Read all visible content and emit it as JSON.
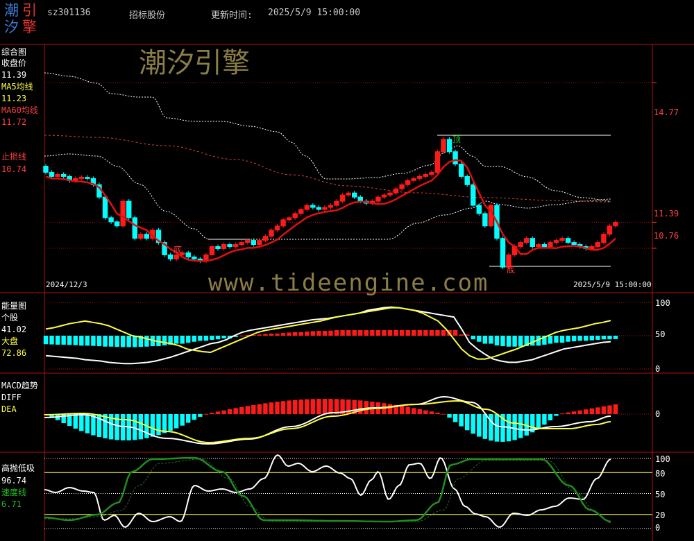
{
  "logo": {
    "c1": "潮",
    "c2": "引",
    "c3": "汐",
    "c4": "擎"
  },
  "header": {
    "code": "sz301136",
    "name": "招标股份",
    "update_label": "更新时间:",
    "update_time": "2025/5/9 15:00:00"
  },
  "watermark": {
    "brand": "潮汐引擎",
    "url": "www.tideengine.com"
  },
  "colors": {
    "up": "#ff1a1a",
    "down": "#00ffff",
    "ma": "#e01010",
    "white": "#ffffff",
    "yellow": "#ffff40",
    "green": "#1f8f1f",
    "grid": "#b01010",
    "axis": "#ff4040"
  },
  "main_panel": {
    "title": "综合图",
    "close_label": "收盘价",
    "close_value": "11.39",
    "ma5_label": "MA5均线",
    "ma5_value": "11.23",
    "ma60_label": "MA60均线",
    "ma60_value": "11.72",
    "stop_label": "止损线",
    "stop_value": "10.74",
    "y_labels": [
      "14.77",
      "11.39",
      "10.76"
    ],
    "date_start": "2024/12/3",
    "date_end": "2025/5/9 15:00:00",
    "markers": [
      {
        "text": "顶"
      },
      {
        "text": "底"
      },
      {
        "text": "底"
      }
    ]
  },
  "energy_panel": {
    "title": "能量图",
    "stock_label": "个股",
    "stock_value": "41.02",
    "market_label": "大盘",
    "market_value": "72.86",
    "y_labels": [
      "100",
      "50",
      "0"
    ]
  },
  "macd_panel": {
    "title": "MACD趋势",
    "diff_label": "DIFF",
    "dea_label": "DEA",
    "y_labels": [
      "0"
    ]
  },
  "hl_panel": {
    "title": "高抛低吸",
    "value1": "96.74",
    "speed_label": "速度线",
    "speed_value": "6.71",
    "y_labels": [
      "100",
      "80",
      "50",
      "20",
      "0"
    ]
  },
  "chart_data": [
    {
      "type": "candlestick",
      "series": [
        {
          "name": "收盘价",
          "values": [
            12.6,
            12.5,
            12.55,
            12.5,
            12.4,
            12.45,
            12.48,
            12.45,
            12.3,
            12.0,
            11.5,
            11.4,
            11.3,
            11.9,
            11.5,
            11.0,
            11.1,
            11.0,
            11.2,
            10.9,
            10.6,
            10.5,
            10.6,
            10.65,
            10.55,
            10.5,
            10.45,
            10.6,
            10.8,
            10.75,
            10.85,
            10.8,
            10.85,
            10.9,
            10.95,
            10.85,
            10.95,
            11.05,
            11.2,
            11.3,
            11.45,
            11.5,
            11.6,
            11.7,
            11.8,
            11.75,
            11.7,
            11.75,
            11.8,
            11.9,
            12.05,
            12.1,
            12.0,
            11.9,
            11.85,
            11.9,
            12.0,
            12.05,
            12.1,
            12.2,
            12.3,
            12.4,
            12.45,
            12.5,
            12.55,
            12.6,
            13.1,
            13.4,
            13.1,
            12.8,
            12.5,
            12.3,
            11.8,
            11.6,
            11.3,
            11.8,
            11.0,
            10.3,
            10.6,
            10.8,
            10.9,
            11.0,
            10.8,
            10.85,
            10.8,
            10.9,
            10.95,
            11.0,
            10.9,
            10.85,
            10.8,
            10.75,
            10.8,
            10.9,
            11.1,
            11.3,
            11.39
          ]
        },
        {
          "name": "MA5均线",
          "values": []
        },
        {
          "name": "MA60均线",
          "values": []
        }
      ],
      "ylim": [
        9.8,
        15.6
      ],
      "y_ticks": [
        14.77,
        11.39,
        10.76
      ]
    },
    {
      "type": "line",
      "series": [
        {
          "name": "个股",
          "values": [
            20,
            19,
            18,
            17,
            16,
            14,
            13,
            12,
            10,
            9,
            8,
            8,
            9,
            10,
            12,
            15,
            18,
            22,
            26,
            30,
            34,
            38,
            40,
            44,
            50,
            55,
            58,
            60,
            62,
            64,
            66,
            68,
            70,
            72,
            74,
            75,
            76,
            78,
            80,
            82,
            84,
            88,
            90,
            92,
            93,
            92,
            90,
            88,
            86,
            84,
            82,
            80,
            78,
            60,
            40,
            30,
            22,
            15,
            12,
            10,
            10,
            12,
            14,
            18,
            22,
            26,
            30,
            32,
            34,
            36,
            38,
            40,
            41.02
          ]
        },
        {
          "name": "大盘",
          "values": [
            60,
            62,
            65,
            68,
            70,
            72,
            70,
            68,
            65,
            60,
            55,
            50,
            48,
            45,
            42,
            40,
            38,
            35,
            30,
            28,
            26,
            25,
            30,
            35,
            40,
            45,
            50,
            55,
            58,
            60,
            62,
            64,
            66,
            68,
            70,
            72,
            75,
            78,
            80,
            82,
            84,
            86,
            88,
            90,
            92,
            92,
            90,
            88,
            84,
            78,
            72,
            60,
            45,
            30,
            20,
            15,
            15,
            18,
            22,
            26,
            30,
            35,
            40,
            45,
            50,
            55,
            58,
            60,
            62,
            65,
            68,
            70,
            72.86
          ]
        }
      ],
      "ylim": [
        0,
        100
      ],
      "y_ticks": [
        100,
        50,
        0
      ]
    },
    {
      "type": "bar",
      "series": [
        {
          "name": "DIFF",
          "values": []
        },
        {
          "name": "DEA",
          "values": []
        }
      ],
      "y_ticks": [
        0
      ]
    },
    {
      "type": "line",
      "series": [
        {
          "name": "高抛低吸",
          "values": []
        },
        {
          "name": "速度线",
          "values": []
        }
      ],
      "ylim": [
        0,
        100
      ],
      "y_ticks": [
        100,
        80,
        50,
        20,
        0
      ]
    }
  ]
}
